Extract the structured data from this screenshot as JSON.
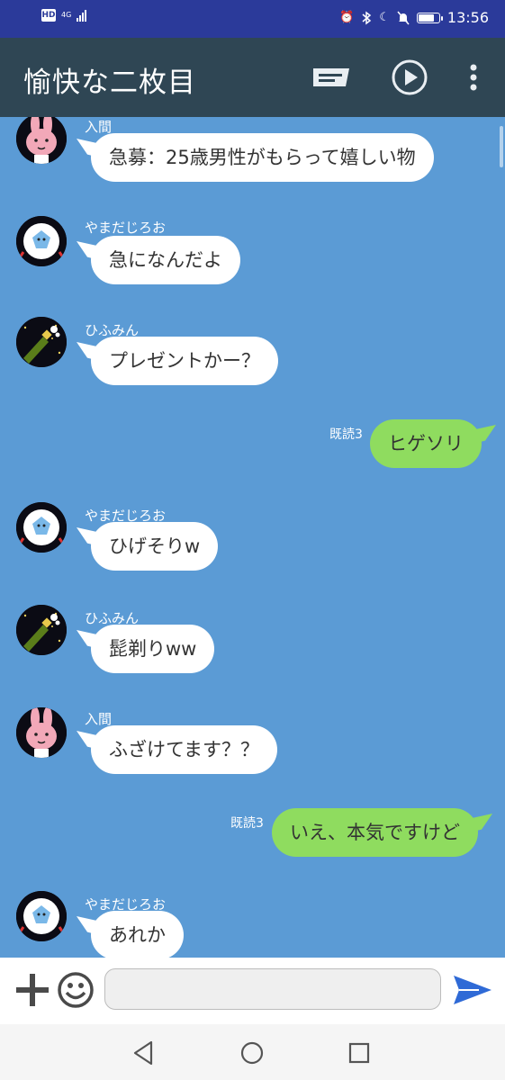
{
  "status_bar": {
    "hd_badge": "HD",
    "network": "4G",
    "time": "13:56",
    "battery_level": 0.7
  },
  "app_bar": {
    "title": "愉快な二枚目",
    "icons": [
      "notes-icon",
      "play-icon",
      "more-vert-icon"
    ]
  },
  "messages": [
    {
      "sender": "入間",
      "text": "急募：25歳男性がもらって嬉しい物",
      "avatar": "rabbit"
    },
    {
      "sender": "やまだじろお",
      "text": "急になんだよ",
      "avatar": "ball"
    },
    {
      "sender": "ひふみん",
      "text": "プレゼントかー？",
      "avatar": "champagne"
    },
    {
      "text": "ヒゲソリ",
      "read": "既読3"
    },
    {
      "sender": "やまだじろお",
      "text": "ひげそりw",
      "avatar": "ball"
    },
    {
      "sender": "ひふみん",
      "text": "髭剃りww",
      "avatar": "champagne"
    },
    {
      "sender": "入間",
      "text": "ふざけてます？？",
      "avatar": "rabbit"
    },
    {
      "text": "いえ、本気ですけど",
      "read": "既読3"
    },
    {
      "sender": "やまだじろお",
      "text": "あれか",
      "avatar": "ball"
    }
  ],
  "input": {
    "placeholder": "",
    "value": ""
  },
  "colors": {
    "status_bar": "#2b3a9a",
    "app_bar": "#2f4654",
    "chat_bg": "#5b9bd5",
    "incoming_bubble": "#ffffff",
    "outgoing_bubble": "#8fdc5f",
    "send_icon": "#2f6ad6"
  }
}
